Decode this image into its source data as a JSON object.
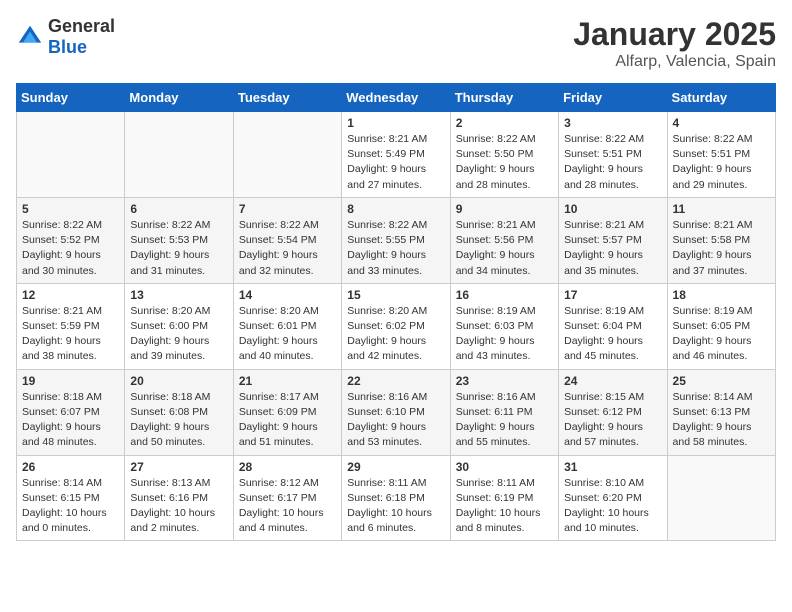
{
  "header": {
    "logo": {
      "general": "General",
      "blue": "Blue"
    },
    "month": "January 2025",
    "location": "Alfarp, Valencia, Spain"
  },
  "weekdays": [
    "Sunday",
    "Monday",
    "Tuesday",
    "Wednesday",
    "Thursday",
    "Friday",
    "Saturday"
  ],
  "weeks": [
    [
      {
        "day": "",
        "sunrise": "",
        "sunset": "",
        "daylight": ""
      },
      {
        "day": "",
        "sunrise": "",
        "sunset": "",
        "daylight": ""
      },
      {
        "day": "",
        "sunrise": "",
        "sunset": "",
        "daylight": ""
      },
      {
        "day": "1",
        "sunrise": "Sunrise: 8:21 AM",
        "sunset": "Sunset: 5:49 PM",
        "daylight": "Daylight: 9 hours and 27 minutes."
      },
      {
        "day": "2",
        "sunrise": "Sunrise: 8:22 AM",
        "sunset": "Sunset: 5:50 PM",
        "daylight": "Daylight: 9 hours and 28 minutes."
      },
      {
        "day": "3",
        "sunrise": "Sunrise: 8:22 AM",
        "sunset": "Sunset: 5:51 PM",
        "daylight": "Daylight: 9 hours and 28 minutes."
      },
      {
        "day": "4",
        "sunrise": "Sunrise: 8:22 AM",
        "sunset": "Sunset: 5:51 PM",
        "daylight": "Daylight: 9 hours and 29 minutes."
      }
    ],
    [
      {
        "day": "5",
        "sunrise": "Sunrise: 8:22 AM",
        "sunset": "Sunset: 5:52 PM",
        "daylight": "Daylight: 9 hours and 30 minutes."
      },
      {
        "day": "6",
        "sunrise": "Sunrise: 8:22 AM",
        "sunset": "Sunset: 5:53 PM",
        "daylight": "Daylight: 9 hours and 31 minutes."
      },
      {
        "day": "7",
        "sunrise": "Sunrise: 8:22 AM",
        "sunset": "Sunset: 5:54 PM",
        "daylight": "Daylight: 9 hours and 32 minutes."
      },
      {
        "day": "8",
        "sunrise": "Sunrise: 8:22 AM",
        "sunset": "Sunset: 5:55 PM",
        "daylight": "Daylight: 9 hours and 33 minutes."
      },
      {
        "day": "9",
        "sunrise": "Sunrise: 8:21 AM",
        "sunset": "Sunset: 5:56 PM",
        "daylight": "Daylight: 9 hours and 34 minutes."
      },
      {
        "day": "10",
        "sunrise": "Sunrise: 8:21 AM",
        "sunset": "Sunset: 5:57 PM",
        "daylight": "Daylight: 9 hours and 35 minutes."
      },
      {
        "day": "11",
        "sunrise": "Sunrise: 8:21 AM",
        "sunset": "Sunset: 5:58 PM",
        "daylight": "Daylight: 9 hours and 37 minutes."
      }
    ],
    [
      {
        "day": "12",
        "sunrise": "Sunrise: 8:21 AM",
        "sunset": "Sunset: 5:59 PM",
        "daylight": "Daylight: 9 hours and 38 minutes."
      },
      {
        "day": "13",
        "sunrise": "Sunrise: 8:20 AM",
        "sunset": "Sunset: 6:00 PM",
        "daylight": "Daylight: 9 hours and 39 minutes."
      },
      {
        "day": "14",
        "sunrise": "Sunrise: 8:20 AM",
        "sunset": "Sunset: 6:01 PM",
        "daylight": "Daylight: 9 hours and 40 minutes."
      },
      {
        "day": "15",
        "sunrise": "Sunrise: 8:20 AM",
        "sunset": "Sunset: 6:02 PM",
        "daylight": "Daylight: 9 hours and 42 minutes."
      },
      {
        "day": "16",
        "sunrise": "Sunrise: 8:19 AM",
        "sunset": "Sunset: 6:03 PM",
        "daylight": "Daylight: 9 hours and 43 minutes."
      },
      {
        "day": "17",
        "sunrise": "Sunrise: 8:19 AM",
        "sunset": "Sunset: 6:04 PM",
        "daylight": "Daylight: 9 hours and 45 minutes."
      },
      {
        "day": "18",
        "sunrise": "Sunrise: 8:19 AM",
        "sunset": "Sunset: 6:05 PM",
        "daylight": "Daylight: 9 hours and 46 minutes."
      }
    ],
    [
      {
        "day": "19",
        "sunrise": "Sunrise: 8:18 AM",
        "sunset": "Sunset: 6:07 PM",
        "daylight": "Daylight: 9 hours and 48 minutes."
      },
      {
        "day": "20",
        "sunrise": "Sunrise: 8:18 AM",
        "sunset": "Sunset: 6:08 PM",
        "daylight": "Daylight: 9 hours and 50 minutes."
      },
      {
        "day": "21",
        "sunrise": "Sunrise: 8:17 AM",
        "sunset": "Sunset: 6:09 PM",
        "daylight": "Daylight: 9 hours and 51 minutes."
      },
      {
        "day": "22",
        "sunrise": "Sunrise: 8:16 AM",
        "sunset": "Sunset: 6:10 PM",
        "daylight": "Daylight: 9 hours and 53 minutes."
      },
      {
        "day": "23",
        "sunrise": "Sunrise: 8:16 AM",
        "sunset": "Sunset: 6:11 PM",
        "daylight": "Daylight: 9 hours and 55 minutes."
      },
      {
        "day": "24",
        "sunrise": "Sunrise: 8:15 AM",
        "sunset": "Sunset: 6:12 PM",
        "daylight": "Daylight: 9 hours and 57 minutes."
      },
      {
        "day": "25",
        "sunrise": "Sunrise: 8:14 AM",
        "sunset": "Sunset: 6:13 PM",
        "daylight": "Daylight: 9 hours and 58 minutes."
      }
    ],
    [
      {
        "day": "26",
        "sunrise": "Sunrise: 8:14 AM",
        "sunset": "Sunset: 6:15 PM",
        "daylight": "Daylight: 10 hours and 0 minutes."
      },
      {
        "day": "27",
        "sunrise": "Sunrise: 8:13 AM",
        "sunset": "Sunset: 6:16 PM",
        "daylight": "Daylight: 10 hours and 2 minutes."
      },
      {
        "day": "28",
        "sunrise": "Sunrise: 8:12 AM",
        "sunset": "Sunset: 6:17 PM",
        "daylight": "Daylight: 10 hours and 4 minutes."
      },
      {
        "day": "29",
        "sunrise": "Sunrise: 8:11 AM",
        "sunset": "Sunset: 6:18 PM",
        "daylight": "Daylight: 10 hours and 6 minutes."
      },
      {
        "day": "30",
        "sunrise": "Sunrise: 8:11 AM",
        "sunset": "Sunset: 6:19 PM",
        "daylight": "Daylight: 10 hours and 8 minutes."
      },
      {
        "day": "31",
        "sunrise": "Sunrise: 8:10 AM",
        "sunset": "Sunset: 6:20 PM",
        "daylight": "Daylight: 10 hours and 10 minutes."
      },
      {
        "day": "",
        "sunrise": "",
        "sunset": "",
        "daylight": ""
      }
    ]
  ]
}
